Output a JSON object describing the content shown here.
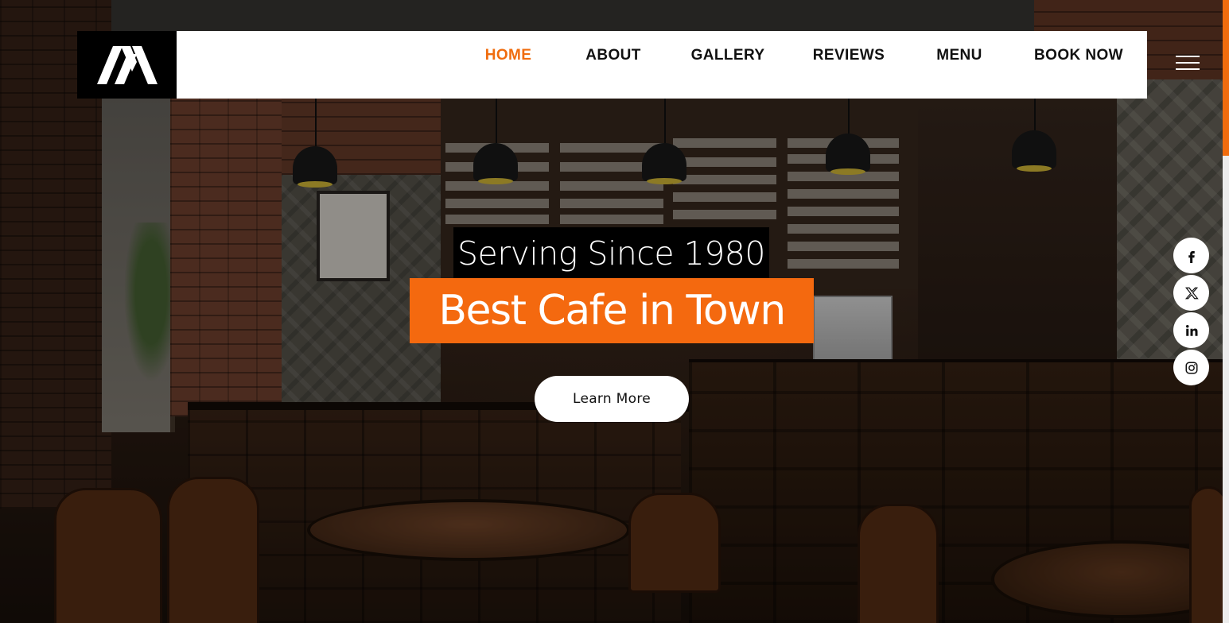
{
  "brand": {
    "logo_icon": "m-logo-icon",
    "accent_color": "#f06c0e"
  },
  "nav": {
    "items": [
      {
        "label": "HOME",
        "active": true
      },
      {
        "label": "ABOUT",
        "active": false
      },
      {
        "label": "GALLERY",
        "active": false
      },
      {
        "label": "REVIEWS",
        "active": false
      },
      {
        "label": "MENU",
        "active": false
      },
      {
        "label": "BOOK NOW",
        "active": false
      }
    ],
    "menu_icon": "hamburger-icon"
  },
  "hero": {
    "subtitle": "Serving Since 1980",
    "title": "Best Cafe in Town",
    "cta_label": "Learn More",
    "background": "cafe interior photo (dark overlay)"
  },
  "social": [
    {
      "name": "facebook",
      "icon": "facebook-icon"
    },
    {
      "name": "x",
      "icon": "x-icon"
    },
    {
      "name": "linkedin",
      "icon": "linkedin-icon"
    },
    {
      "name": "instagram",
      "icon": "instagram-icon"
    }
  ],
  "colors": {
    "title_bg": "#f4690f",
    "subtitle_bg": "#000000",
    "nav_active": "#f06c0e",
    "nav_text": "#111111"
  }
}
